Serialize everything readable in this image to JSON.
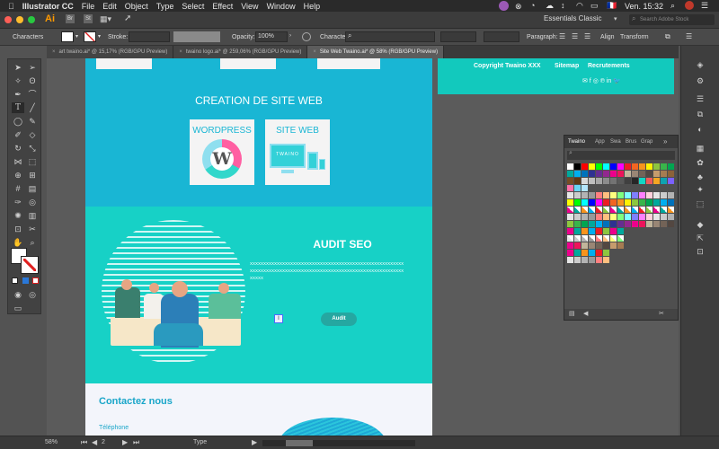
{
  "mac_menu": {
    "app": "Illustrator CC",
    "items": [
      "File",
      "Edit",
      "Object",
      "Type",
      "Select",
      "Effect",
      "View",
      "Window",
      "Help"
    ],
    "clock": "Ven. 15:32",
    "flag": "🇫🇷"
  },
  "app_bar": {
    "logo": "Ai",
    "workspace": "Essentials Classic",
    "search_placeholder": "Search Adobe Stock"
  },
  "control_bar": {
    "selection": "Characters",
    "stroke_label": "Stroke:",
    "opacity_label": "Opacity:",
    "opacity_value": "100%",
    "character_label": "Character:",
    "paragraph_label": "Paragraph:",
    "align_label": "Align",
    "transform_label": "Transform"
  },
  "tabs": [
    "art twaino.ai* @ 15,17% (RGB/GPU Preview)",
    "twaino logo.ai* @ 259,06% (RGB/GPU Preview)",
    "Site Web Twaino.ai* @ 58% (RGB/GPU Preview)"
  ],
  "artboard": {
    "footer": {
      "copyright": "Copyright Twaino XXX",
      "sitemap": "Sitemap",
      "recruit": "Recrutements",
      "socials": "✉ f ◎ ℗ in 🐦"
    },
    "creation": {
      "title": "CREATION DE SITE WEB",
      "card1": "WORDPRESS",
      "card2": "SITE WEB",
      "screen_text": "TWAINO"
    },
    "audit": {
      "title": "AUDIT SEO",
      "lorem1": "XXXXXXXXXXXXXXXXXXXXXXXXXXXXXXXXXXXXXXXXXXXXXXXXXXXXXXXXX",
      "lorem2": "XXXXXXXXXXXXXXXXXXXXXXXXXXXXXXXXXXXXXXXXXXXXXXXXXXXXXXXXX",
      "lorem3": "XXXXX",
      "button": "Audit"
    },
    "contact": {
      "title": "Contactez nous",
      "phone": "Téléphone"
    }
  },
  "swatches_panel": {
    "tabs": [
      "Twaino",
      "App",
      "Swa",
      "Brus",
      "Grap"
    ],
    "colors": [
      "#ffffff",
      "#000000",
      "#ff0000",
      "#ffff00",
      "#00ff00",
      "#00ffff",
      "#0000ff",
      "#ff00ff",
      "#ed1c24",
      "#f26522",
      "#f7941d",
      "#fff200",
      "#8dc63f",
      "#39b54a",
      "#00a651",
      "#00a99d",
      "#00aeef",
      "#0072bc",
      "#2e3192",
      "#662d91",
      "#92278f",
      "#ec008c",
      "#ed145b",
      "#c2b59b",
      "#998675",
      "#736357",
      "#534741",
      "#c69c6d",
      "#a67c52",
      "#8c6239",
      "#754c24",
      "#603913",
      "#d9d9d9",
      "#bfbfbf",
      "#a6a6a6",
      "#8c8c8c",
      "#737373",
      "#595959",
      "#404040",
      "#262626",
      "#12d6c4",
      "#ef5a5a",
      "#f5a623",
      "#0fa3b1",
      "#7b61ff",
      "#ff6fa8",
      "#6ad3f3",
      "#b3e5fc"
    ],
    "rows": [
      "#e6e6e6",
      "#cccccc",
      "#b3b3b3",
      "#999999",
      "#ff7f7f",
      "#ffbf7f",
      "#ffff7f",
      "#7fff7f",
      "#7fffff",
      "#7f7fff",
      "#ff7fff",
      "#ffd1dc"
    ],
    "accent": [
      "#ec008c",
      "#00a99d",
      "#f7941d",
      "#00aeef",
      "#ed1c24",
      "#8dc63f"
    ]
  },
  "status_bar": {
    "zoom": "58%",
    "artboard": "2",
    "mode": "Type"
  },
  "colors": {
    "teal": "#19b9d6",
    "cyan": "#14cfc9",
    "footer_teal": "#12c9bd",
    "audit_bg": "#18d3c7"
  }
}
